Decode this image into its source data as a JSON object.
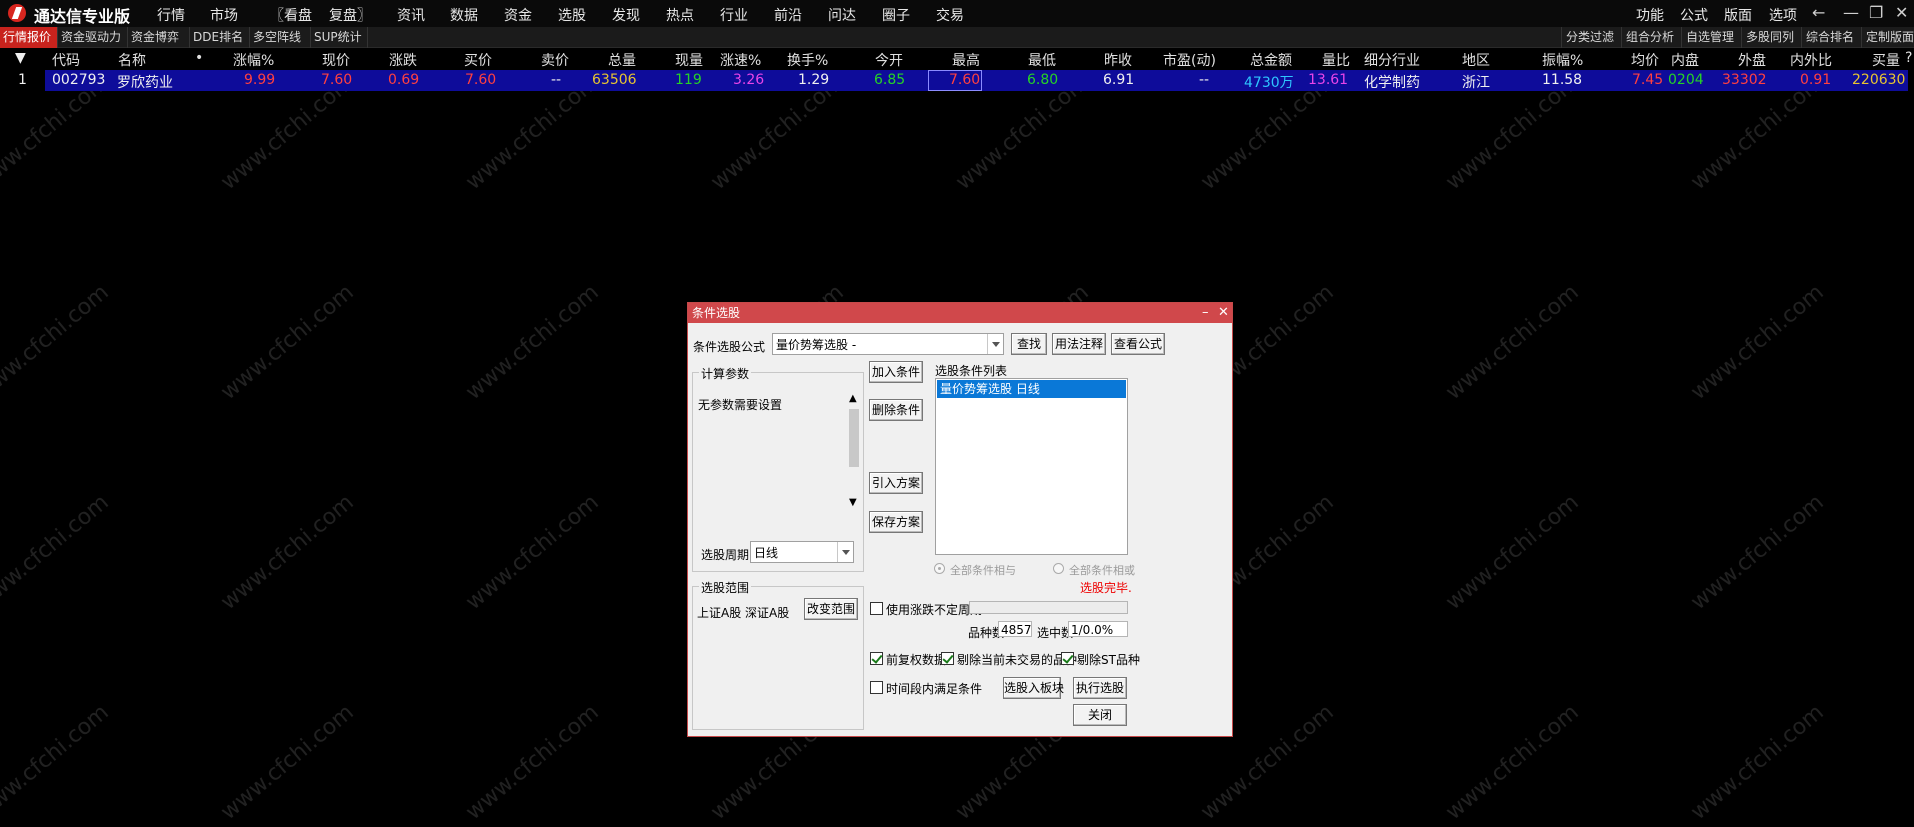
{
  "app": {
    "title": "通达信专业版"
  },
  "menu": [
    "行情",
    "市场",
    "〖看盘",
    "复盘〗",
    "资讯",
    "数据",
    "资金",
    "选股",
    "发现",
    "热点",
    "行业",
    "前沿",
    "问达",
    "圈子",
    "交易"
  ],
  "right_menu": [
    "功能",
    "公式",
    "版面",
    "选项"
  ],
  "window_controls": {
    "back": "←",
    "minimize": "—",
    "restore": "❐",
    "close": "✕"
  },
  "subtabs": [
    "行情报价",
    "资金驱动力",
    "资金博弈",
    "DDE排名",
    "多空阵线",
    "SUP统计"
  ],
  "right_subtabs": [
    "分类过滤",
    "组合分析",
    "自选管理",
    "多股同列",
    "综合排名",
    "定制版面"
  ],
  "table": {
    "sort_glyph": "▼",
    "headers": [
      "代码",
      "名称",
      "•",
      "涨幅%",
      "现价",
      "涨跌",
      "买价",
      "卖价",
      "总量",
      "现量",
      "涨速%",
      "换手%",
      "今开",
      "最高",
      "最低",
      "昨收",
      "市盈(动)",
      "总金额",
      "量比",
      "细分行业",
      "地区",
      "振幅%",
      "均价",
      "内盘",
      "外盘",
      "内外比",
      "买量",
      "?"
    ],
    "row": {
      "index": "1",
      "code": "002793",
      "name": "罗欣药业",
      "change_pct": "9.99",
      "price": "7.60",
      "change": "0.69",
      "bid": "7.60",
      "ask": "--",
      "volume": "63506",
      "cur_vol": "119",
      "speed": "3.26",
      "turnover": "1.29",
      "open": "6.85",
      "high": "7.60",
      "low": "6.80",
      "prev_close": "6.91",
      "pe": "--",
      "amount": "4730万",
      "vol_ratio": "13.61",
      "industry": "化学制药",
      "region": "浙江",
      "amplitude": "11.58",
      "avg_price": "7.45",
      "inner": "0204",
      "outer": "33302",
      "io_ratio": "0.91",
      "buy_vol": "220630"
    }
  },
  "dialog": {
    "title": "条件选股",
    "formula_label": "条件选股公式",
    "formula_value": "量价势筹选股 -",
    "find_btn": "查找",
    "usage_btn": "用法注释",
    "view_btn": "查看公式",
    "params_group": "计算参数",
    "no_params": "无参数需要设置",
    "period_label": "选股周期:",
    "period_value": "日线",
    "add_cond": "加入条件",
    "del_cond": "删除条件",
    "import_plan": "引入方案",
    "save_plan": "保存方案",
    "cond_list_label": "选股条件列表",
    "cond_items": [
      "量价势筹选股  日线"
    ],
    "radio_and": "全部条件相与",
    "radio_or": "全部条件相或",
    "status": "选股完毕.",
    "range_group": "选股范围",
    "range_value": "上证A股 深证A股",
    "change_range": "改变范围",
    "use_irregular": "使用涨跌不定周期",
    "count_label": "品种数",
    "count_value": "4857",
    "selected_label": "选中数",
    "selected_value": "1/0.0%",
    "pre_adjust": "前复权数据",
    "remove_untraded": "剔除当前未交易的品种",
    "remove_st": "剔除ST品种",
    "period_within": "时间段内满足条件",
    "to_block": "选股入板块",
    "execute": "执行选股",
    "close": "关闭"
  },
  "watermark": "www.cfchi.com",
  "colors": {
    "title_red": "#d0484b",
    "selected_row": "#0e0c9a",
    "up_red": "#ff4040",
    "green": "#26d326"
  }
}
